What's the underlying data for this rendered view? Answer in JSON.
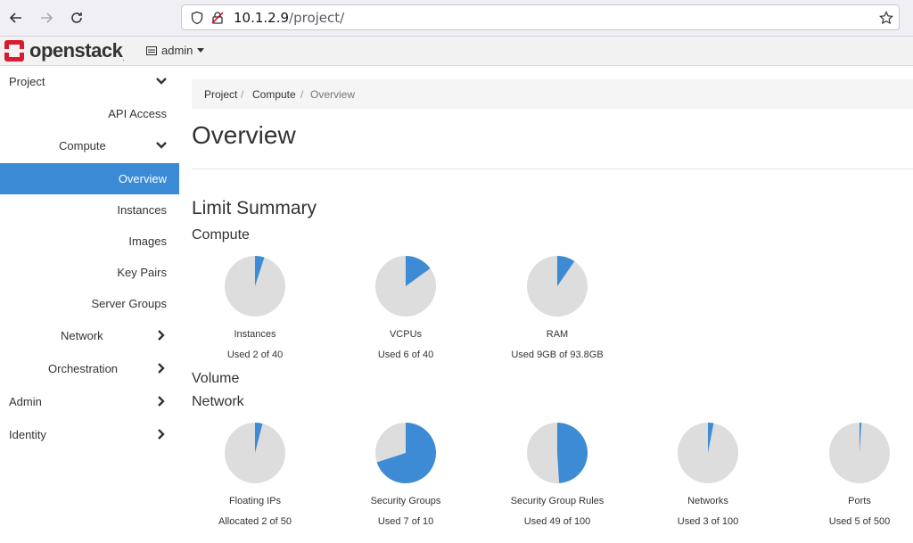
{
  "browser": {
    "url_host": "10.1.2.9",
    "url_path": "/project/"
  },
  "header": {
    "logo_text": "openstack",
    "logo_reg": ".",
    "project_menu": "admin"
  },
  "sidebar": {
    "items": [
      {
        "label": "Project",
        "chevron": "down"
      },
      {
        "label": "API Access",
        "chevron": ""
      },
      {
        "label": "Compute",
        "chevron": "down"
      },
      {
        "label": "Overview",
        "chevron": "",
        "active": true
      },
      {
        "label": "Instances",
        "chevron": ""
      },
      {
        "label": "Images",
        "chevron": ""
      },
      {
        "label": "Key Pairs",
        "chevron": ""
      },
      {
        "label": "Server Groups",
        "chevron": ""
      },
      {
        "label": "Network",
        "chevron": "right"
      },
      {
        "label": "Orchestration",
        "chevron": "right"
      },
      {
        "label": "Admin",
        "chevron": "right"
      },
      {
        "label": "Identity",
        "chevron": "right"
      }
    ]
  },
  "breadcrumb": {
    "items": [
      "Project",
      "Compute",
      "Overview"
    ],
    "separator": "/"
  },
  "page_title": "Overview",
  "limit_summary": {
    "heading": "Limit Summary",
    "compute_heading": "Compute",
    "volume_heading": "Volume",
    "network_heading": "Network",
    "compute": [
      {
        "label": "Instances",
        "usage": "Used 2 of 40",
        "used": 2,
        "total": 40
      },
      {
        "label": "VCPUs",
        "usage": "Used 6 of 40",
        "used": 6,
        "total": 40
      },
      {
        "label": "RAM",
        "usage": "Used 9GB of 93.8GB",
        "used": 9,
        "total": 93.8
      }
    ],
    "network": [
      {
        "label": "Floating IPs",
        "usage": "Allocated 2 of 50",
        "used": 2,
        "total": 50
      },
      {
        "label": "Security Groups",
        "usage": "Used 7 of 10",
        "used": 7,
        "total": 10
      },
      {
        "label": "Security Group Rules",
        "usage": "Used 49 of 100",
        "used": 49,
        "total": 100
      },
      {
        "label": "Networks",
        "usage": "Used 3 of 100",
        "used": 3,
        "total": 100
      },
      {
        "label": "Ports",
        "usage": "Used 5 of 500",
        "used": 5,
        "total": 500
      }
    ]
  },
  "colors": {
    "accent": "#3b8ad6",
    "pie_used": "#3d8bd4",
    "pie_free": "#dddddd",
    "logo_red": "#da1a32"
  }
}
